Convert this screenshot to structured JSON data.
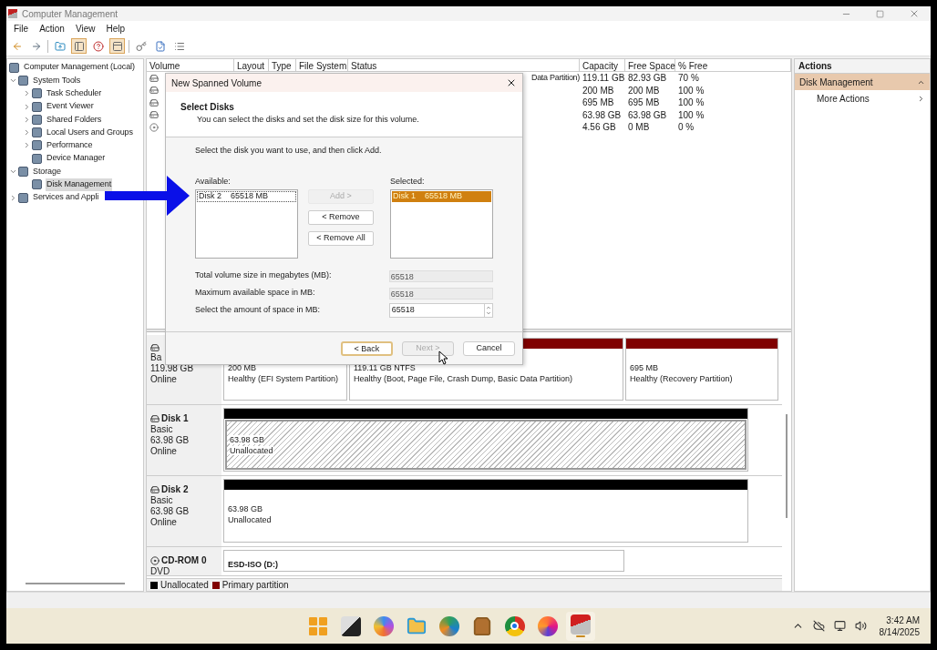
{
  "window": {
    "title": "Computer Management"
  },
  "menu": [
    "File",
    "Action",
    "View",
    "Help"
  ],
  "toolbar": [
    {
      "kind": "back",
      "on": false
    },
    {
      "kind": "forward",
      "on": false
    },
    {
      "kind": "up",
      "on": false
    },
    {
      "kind": "tree",
      "on": true
    },
    {
      "kind": "help",
      "on": false
    },
    {
      "kind": "pane",
      "on": true
    },
    {
      "kind": "key",
      "on": false
    },
    {
      "kind": "check",
      "on": false
    },
    {
      "kind": "list",
      "on": false
    }
  ],
  "tree": [
    {
      "label": "Computer Management (Local)",
      "selected": false,
      "children": [
        {
          "label": "System Tools",
          "selected": false,
          "expanded": true,
          "children": [
            {
              "label": "Task Scheduler",
              "selected": false,
              "expanded": false
            },
            {
              "label": "Event Viewer",
              "selected": false,
              "expanded": false
            },
            {
              "label": "Shared Folders",
              "selected": false,
              "expanded": false
            },
            {
              "label": "Local Users and Groups",
              "selected": false,
              "expanded": false
            },
            {
              "label": "Performance",
              "selected": false,
              "expanded": false
            },
            {
              "label": "Device Manager",
              "selected": false
            }
          ]
        },
        {
          "label": "Storage",
          "selected": false,
          "expanded": true,
          "children": [
            {
              "label": "Disk Management",
              "selected": true
            }
          ]
        },
        {
          "label": "Services and Appli",
          "selected": false,
          "expanded": false
        }
      ]
    }
  ],
  "volumes": {
    "columns": [
      "Volume",
      "Layout",
      "Type",
      "File System",
      "Status",
      "Capacity",
      "Free Space",
      "% Free"
    ],
    "rows": [
      {
        "kind": "disk",
        "status": "Data Partition)",
        "capacity": "119.11 GB",
        "free": "82.93 GB",
        "pct": "70 %"
      },
      {
        "kind": "disk",
        "capacity": "200 MB",
        "free": "200 MB",
        "pct": "100 %"
      },
      {
        "kind": "disk",
        "capacity": "695 MB",
        "free": "695 MB",
        "pct": "100 %"
      },
      {
        "kind": "disk",
        "capacity": "63.98 GB",
        "free": "63.98 GB",
        "pct": "100 %"
      },
      {
        "kind": "cd",
        "capacity": "4.56 GB",
        "free": "0 MB",
        "pct": "0 %"
      }
    ]
  },
  "disks": [
    {
      "kind": "disk",
      "lines": [
        "Ba",
        "119.98 GB",
        "Online"
      ],
      "partitions": [
        {
          "kind": "primary",
          "selected": false,
          "size": "200 MB",
          "status": "Healthy (EFI System Partition)"
        },
        {
          "kind": "primary",
          "selected": false,
          "size": "119.11 GB NTFS",
          "status": "Healthy (Boot, Page File, Crash Dump, Basic Data Partition)"
        },
        {
          "kind": "primary",
          "selected": false,
          "size": "695 MB",
          "status": "Healthy (Recovery Partition)"
        }
      ]
    },
    {
      "kind": "disk",
      "name": "Disk 1",
      "lines": [
        "Basic",
        "63.98 GB",
        "Online"
      ],
      "partitions": [
        {
          "kind": "unallocated",
          "selected": true,
          "size": "63.98 GB",
          "status": "Unallocated"
        }
      ]
    },
    {
      "kind": "disk",
      "name": "Disk 2",
      "lines": [
        "Basic",
        "63.98 GB",
        "Online"
      ],
      "partitions": [
        {
          "kind": "unallocated",
          "selected": false,
          "size": "63.98 GB",
          "status": "Unallocated"
        }
      ]
    },
    {
      "kind": "cd",
      "name": "CD-ROM 0",
      "lines": [
        "DVD"
      ],
      "partitions": [
        {
          "kind": "primary",
          "selected": false,
          "label": "ESD-ISO  (D:)"
        }
      ]
    }
  ],
  "legend": [
    {
      "label": "Unallocated",
      "color": "#000000"
    },
    {
      "label": "Primary partition",
      "color": "#800000"
    }
  ],
  "actions": {
    "title": "Actions",
    "section": "Disk Management",
    "items": [
      "More Actions"
    ]
  },
  "dialog": {
    "title": "New Spanned Volume",
    "heading": "Select Disks",
    "subtitle": "You can select the disks and set the disk size for this volume.",
    "instruction": "Select the disk you want to use, and then click Add.",
    "available": {
      "label": "Available:",
      "items": [
        {
          "name": "Disk 2",
          "size": "65518 MB",
          "selected": false
        }
      ]
    },
    "selected": {
      "label": "Selected:",
      "items": [
        {
          "name": "Disk 1",
          "size": "65518 MB",
          "selected": true
        }
      ]
    },
    "move_buttons": [
      {
        "label": "Add >",
        "disabled": true
      },
      {
        "label": "< Remove",
        "disabled": false
      },
      {
        "label": "< Remove All",
        "disabled": false
      }
    ],
    "fields": [
      {
        "kind": "readonly",
        "label": "Total volume size in megabytes (MB):",
        "value": "65518"
      },
      {
        "kind": "readonly",
        "label": "Maximum available space in MB:",
        "value": "65518"
      },
      {
        "kind": "spin",
        "label": "Select the amount of space in MB:",
        "value": "65518"
      }
    ],
    "buttons": [
      {
        "label": "< Back",
        "disabled": false,
        "default": true
      },
      {
        "label": "Next >",
        "disabled": true,
        "default": false
      },
      {
        "label": "Cancel",
        "disabled": false,
        "default": false
      }
    ]
  },
  "taskbar": {
    "apps": [
      {
        "kind": "start",
        "active": false
      },
      {
        "kind": "taskview",
        "active": false
      },
      {
        "kind": "copilot",
        "active": false
      },
      {
        "kind": "explorer",
        "active": false
      },
      {
        "kind": "edge",
        "active": false
      },
      {
        "kind": "store",
        "active": false
      },
      {
        "kind": "chrome",
        "active": false
      },
      {
        "kind": "firefox",
        "active": false
      },
      {
        "kind": "compmgmt",
        "active": true
      }
    ],
    "tray": [
      {
        "kind": "chevron"
      },
      {
        "kind": "cloud"
      },
      {
        "kind": "network"
      },
      {
        "kind": "volume"
      }
    ],
    "time": "3:42 AM",
    "date": "8/14/2025"
  }
}
